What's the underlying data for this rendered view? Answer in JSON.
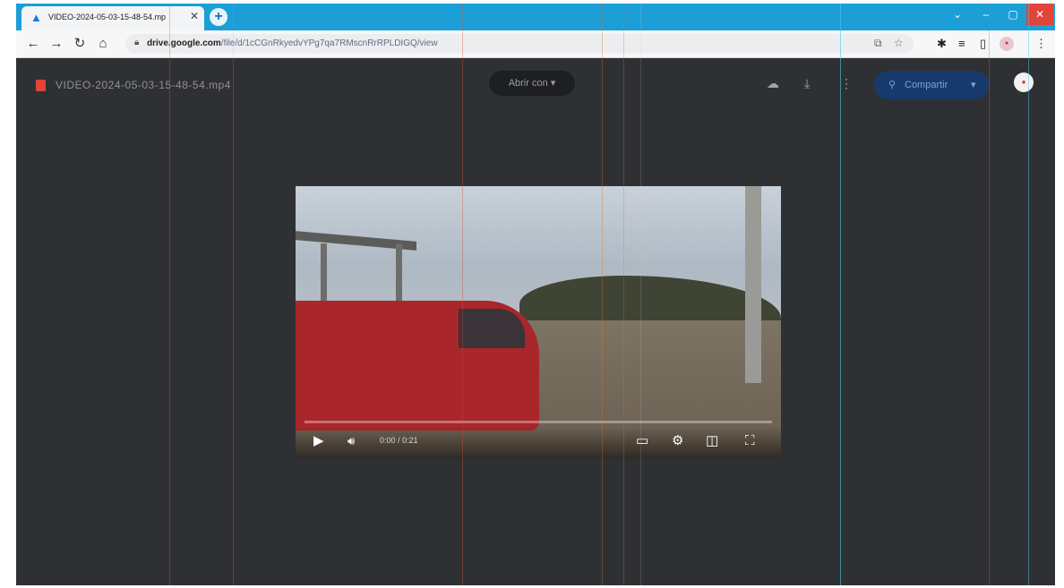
{
  "browser": {
    "tab_title": "VIDEO-2024-05-03-15-48-54.mp",
    "tab_close": "✕",
    "new_tab": "+",
    "url_domain": "drive.google.com",
    "url_path": "/file/d/1cCGnRkyedvYPg7qa7RMscnRrRPLDIGQ/view",
    "window_controls": [
      "⌄",
      "–",
      "▢",
      "✕"
    ]
  },
  "viewer": {
    "file_name": "VIDEO-2024-05-03-15-48-54.mp4",
    "open_with_label": "Abrir con",
    "share_label": "Compartir"
  },
  "video": {
    "time_display": "0:00 / 0:21",
    "progress": 0.0
  },
  "icons": {
    "back": "arrow-left-icon",
    "forward": "arrow-right-icon",
    "reload": "reload-icon",
    "home": "home-icon",
    "lock": "lock-icon",
    "add_shortcut": "add-to-drive-icon",
    "download": "download-icon",
    "more": "more-vert-icon",
    "play": "play-icon",
    "volume": "volume-icon",
    "captions": "captions-icon",
    "settings": "gear-icon",
    "miniplayer": "miniplayer-icon",
    "fullscreen": "fullscreen-icon"
  },
  "colors": {
    "titlebar": "#1b9fd6",
    "viewer_bg": "#2f3034",
    "share_button": "#153a6b",
    "progress": "#4ea2e8"
  }
}
